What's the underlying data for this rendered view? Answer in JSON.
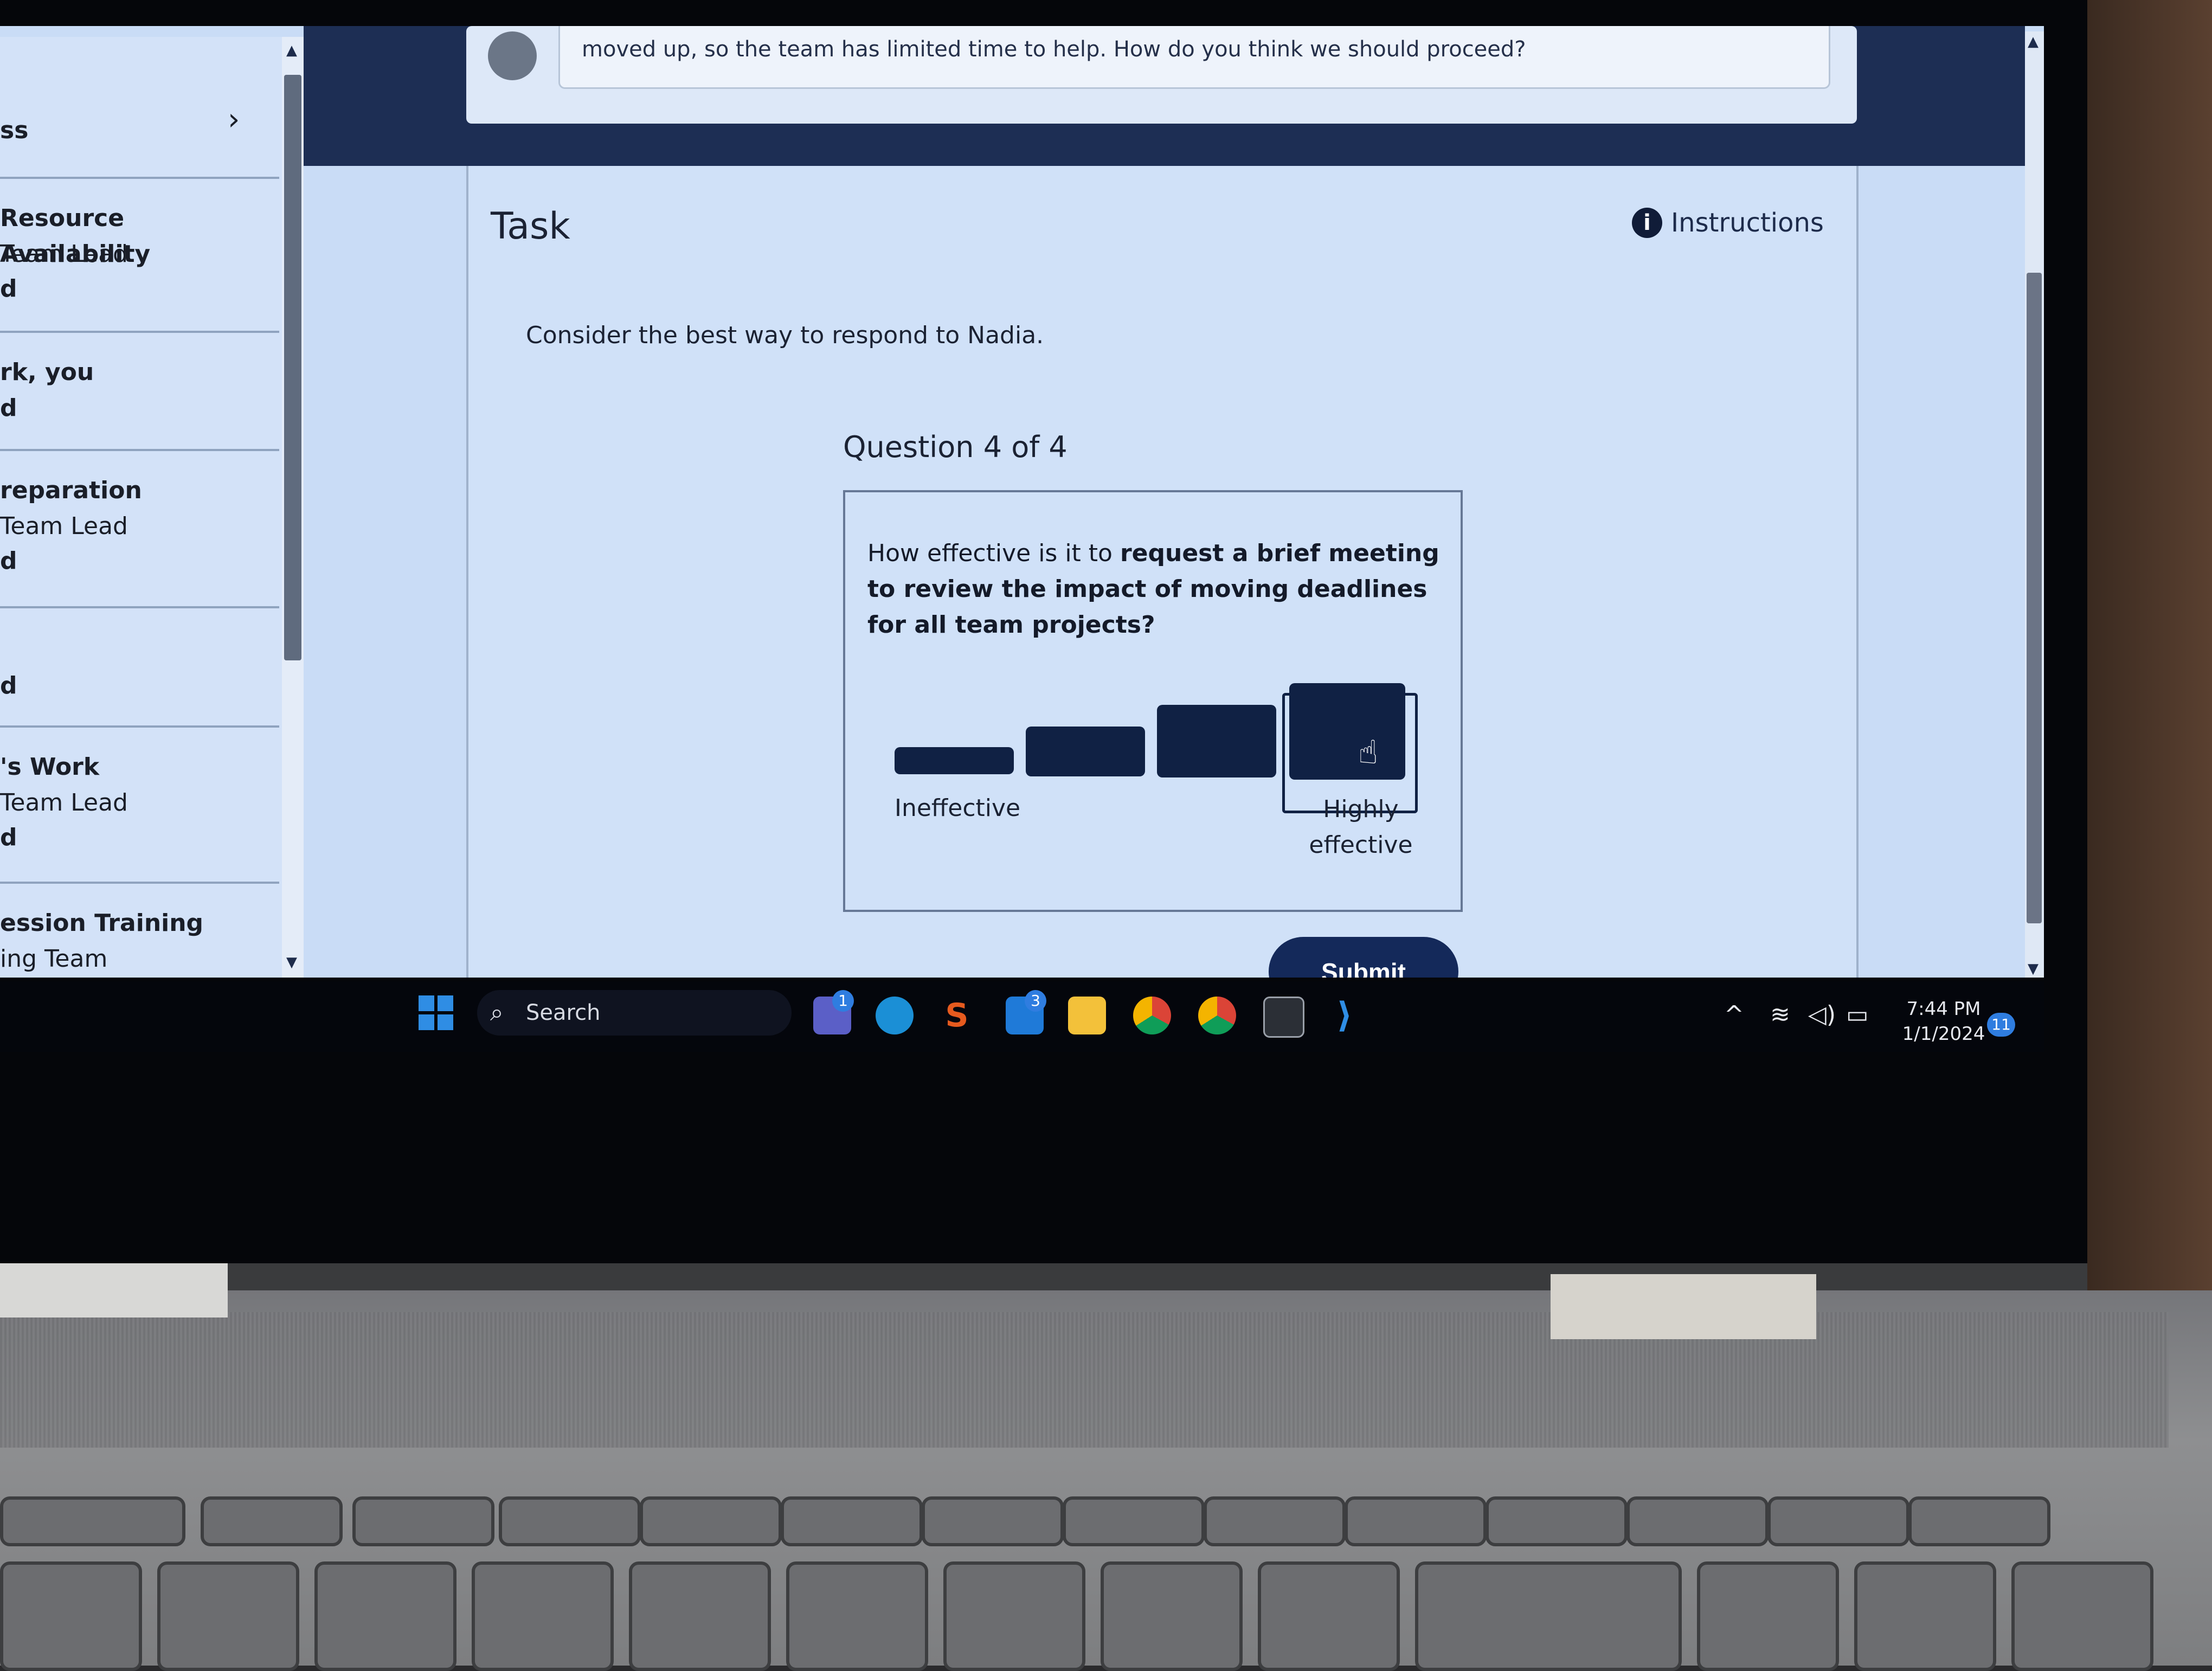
{
  "sidebar": {
    "items": [
      {
        "title": "ss",
        "sub": "",
        "status": ""
      },
      {
        "title": "Resource Availability",
        "sub": "Team Lead",
        "status": "d"
      },
      {
        "title": "rk, you",
        "sub": "",
        "status": "d"
      },
      {
        "title": "reparation",
        "sub": "Team Lead",
        "status": "d"
      },
      {
        "title": "",
        "sub": "",
        "status": "d"
      },
      {
        "title": "'s Work",
        "sub": "Team Lead",
        "status": "d"
      },
      {
        "title": "ession Training",
        "sub": "ing Team",
        "status": "d"
      }
    ],
    "expand_icon": "chevron-right-icon"
  },
  "chat": {
    "message": "moved up, so the team has limited time to help. How do you think we should proceed?"
  },
  "task": {
    "title": "Task",
    "instructions_label": "Instructions",
    "prompt": "Consider the best way to respond to Nadia."
  },
  "question": {
    "counter": "Question 4 of 4",
    "text_prefix": "How effective is it to ",
    "text_bold": "request a brief meeting to review the impact of moving deadlines for all team projects?",
    "scale_low_label": "Ineffective",
    "scale_high_label": "Highly effective",
    "options_count": 4,
    "selected_option": 4
  },
  "submit_label": "Submit",
  "taskbar": {
    "search_placeholder": "Search",
    "teams_badge": "1",
    "mail_badge": "3",
    "time": "7:44 PM",
    "date": "1/1/2024",
    "notification_count": "11"
  },
  "colors": {
    "accent": "#102144",
    "page_bg": "#c9dcf6",
    "windows_blue": "#2f8de4"
  }
}
